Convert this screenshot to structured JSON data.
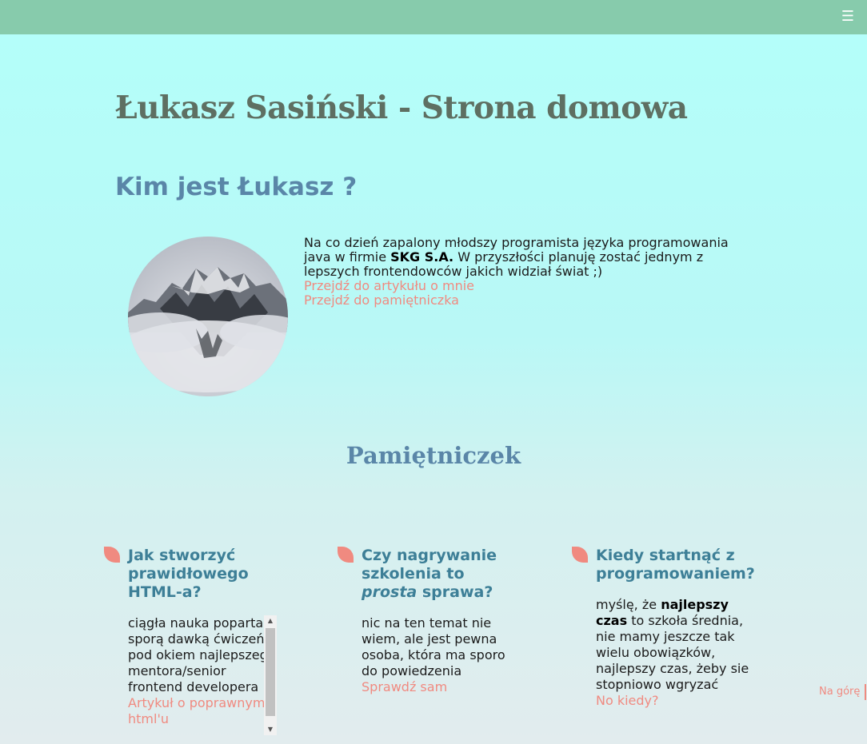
{
  "header": {
    "menu_icon": "hamburger-icon",
    "menu_glyph": "☰"
  },
  "site_title": "Łukasz Sasiński - Strona domowa",
  "about": {
    "heading": "Kim jest Łukasz ?",
    "image_alt": "mountain peaks in fog",
    "text_before": "Na co dzień zapalony młodszy programista języka programowania java w firmie ",
    "company": "SKG S.A.",
    "text_after": " W przyszłości planuję zostać jednym z lepszych frontendowców jakich widział świat ;)",
    "link_article": "Przejdź do artykułu o mnie",
    "link_diary": "Przejdź do pamiętniczka"
  },
  "diary": {
    "heading": "Pamiętniczek",
    "cards": [
      {
        "title": "Jak stworzyć prawidłowego HTML-a?",
        "body": "ciągła nauka poparta sporą dawką ćwiczeń pod okiem najlepszego mentora/senior frontend developera",
        "link": "Artykuł o poprawnym html'u"
      },
      {
        "title_before": "Czy nagrywanie szkolenia to ",
        "title_em": "prosta",
        "title_after": " sprawa?",
        "body": "nic na ten temat nie wiem, ale jest pewna osoba, która ma sporo do powiedzenia",
        "link": "Sprawdź sam"
      },
      {
        "title": "Kiedy startnąć z programowaniem?",
        "body_before": "myślę, że ",
        "body_bold": "najlepszy czas",
        "body_after": " to szkoła średnia, nie mamy jeszcze tak wielu obowiązków, najlepszy czas, żeby sie stopniowo wgryzać",
        "link": "No kiedy?"
      }
    ]
  },
  "to_top": "Na górę",
  "colors": {
    "topbar": "#87cbac",
    "accent_link": "#f08a80",
    "heading_blue": "#5a86a8",
    "card_title": "#3d7f97",
    "title_gray": "#5e6f62"
  }
}
